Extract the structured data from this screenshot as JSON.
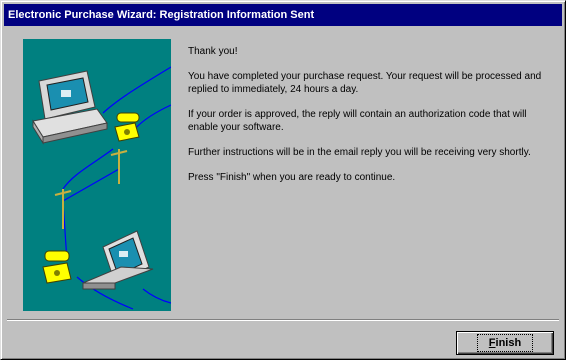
{
  "window": {
    "title": "Electronic Purchase Wizard: Registration Information Sent"
  },
  "main": {
    "paragraphs": [
      "Thank you!",
      "You have completed your purchase request. Your request will be processed and replied to immediately, 24 hours a day.",
      "If your order is approved, the reply will contain an authorization code that will enable your software.",
      "Further instructions will be in the email reply you will be receiving very shortly.",
      "Press \"Finish\" when you are ready to continue."
    ]
  },
  "buttons": {
    "finish_accel": "F",
    "finish_rest": "inish"
  },
  "illustration": {
    "icons": [
      "desktop-computer-icon",
      "telephone-icon",
      "telephone-pole-icon",
      "telephone-icon",
      "laptop-computer-icon"
    ],
    "colors": {
      "background": "#008080",
      "wire": "#0000ff",
      "phone": "#ffff00",
      "pole": "#c8b040"
    }
  },
  "colors": {
    "titlebar": "#000080",
    "face": "#c0c0c0"
  }
}
